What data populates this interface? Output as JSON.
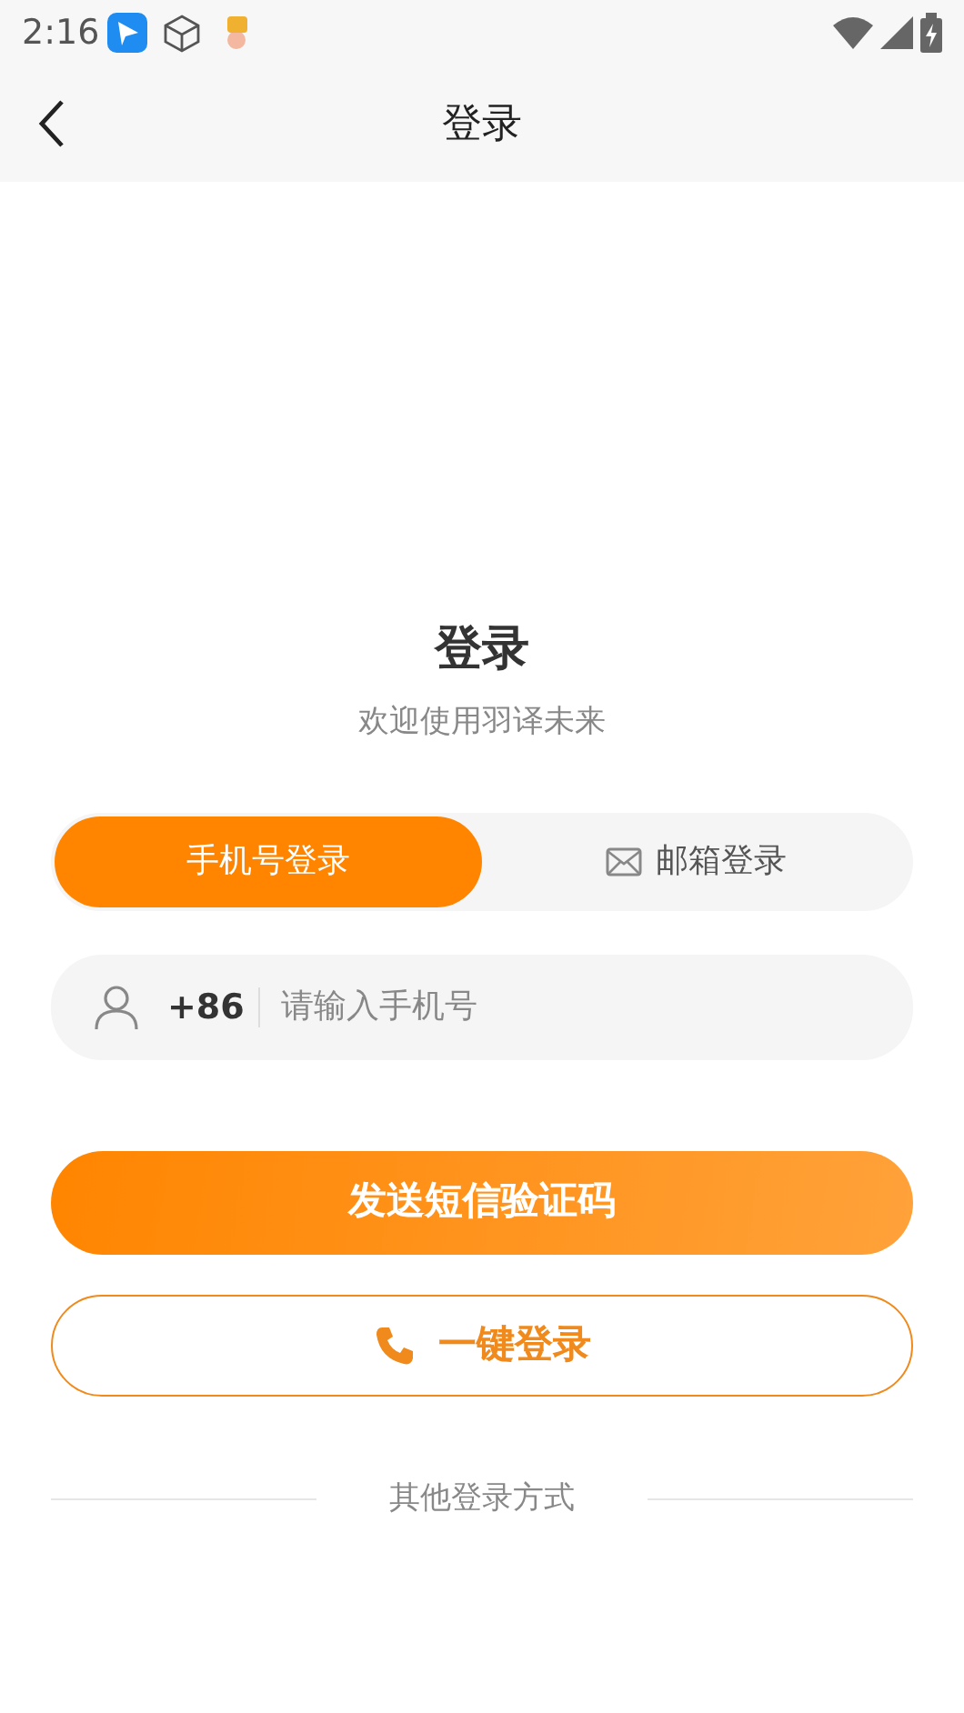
{
  "status_bar": {
    "time": "2:16"
  },
  "header": {
    "title": "登录"
  },
  "heading": "登录",
  "subtitle": "欢迎使用羽译未来",
  "tabs": [
    {
      "label": "手机号登录",
      "selected": true,
      "kind": "phone"
    },
    {
      "label": "邮箱登录",
      "selected": false,
      "kind": "email"
    }
  ],
  "phone_field": {
    "prefix": "+86",
    "placeholder": "请输入手机号"
  },
  "send_code_button": "发送短信验证码",
  "one_click_button": "一键登录",
  "other_methods": "其他登录方式"
}
